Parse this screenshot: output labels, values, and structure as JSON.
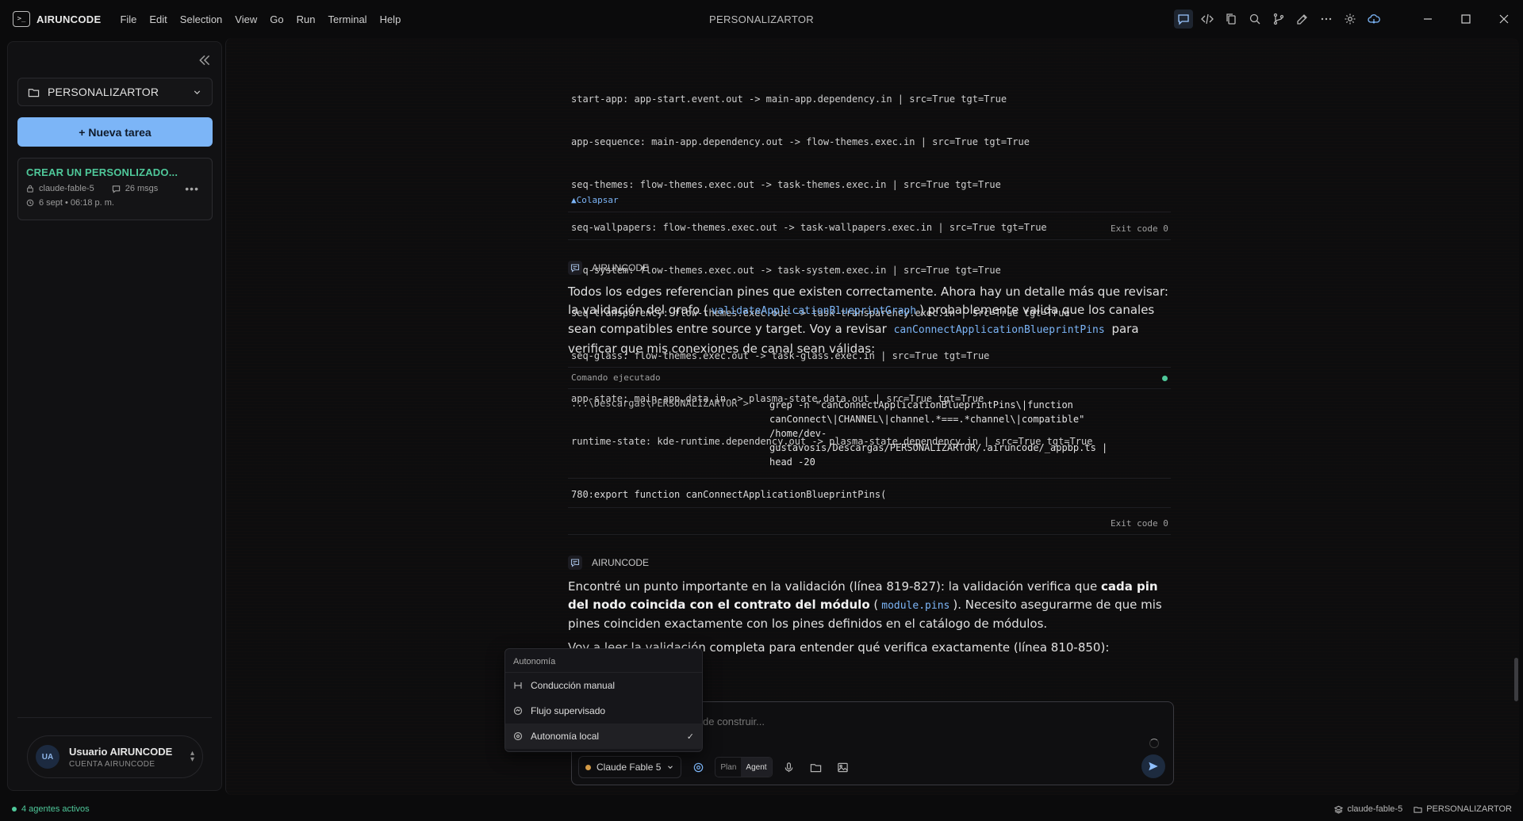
{
  "app": {
    "logo_glyph": ">_",
    "name": "AIRUNCODE",
    "window_title": "PERSONALIZARTOR"
  },
  "menu": [
    "File",
    "Edit",
    "Selection",
    "View",
    "Go",
    "Run",
    "Terminal",
    "Help"
  ],
  "sidebar": {
    "project": "PERSONALIZARTOR",
    "new_task": "+ Nueva tarea",
    "task": {
      "title": "CREAR UN PERSONLIZADO...",
      "agent": "claude-fable-5",
      "messages": "26 msgs",
      "date": "6 sept • 06:18 p. m."
    },
    "user": {
      "initials": "UA",
      "name": "Usuario AIRUNCODE",
      "account": "CUENTA AIRUNCODE"
    }
  },
  "conversation": {
    "edge_lines": [
      "start-app: app-start.event.out -> main-app.dependency.in | src=True tgt=True",
      "app-sequence: main-app.dependency.out -> flow-themes.exec.in | src=True tgt=True",
      "seq-themes: flow-themes.exec.out -> task-themes.exec.in | src=True tgt=True",
      "seq-wallpapers: flow-themes.exec.out -> task-wallpapers.exec.in | src=True tgt=True",
      "seq-system: flow-themes.exec.out -> task-system.exec.in | src=True tgt=True",
      "seq-transparency: flow-themes.exec.out -> task-transparency.exec.in | src=True tgt=True",
      "seq-glass: flow-themes.exec.out -> task-glass.exec.in | src=True tgt=True",
      "app-state: main-app.data.in -> plasma-state.data.out | src=True tgt=True",
      "runtime-state: kde-runtime.dependency.out -> plasma-state.dependency.in | src=True tgt=True"
    ],
    "collapse_label": "▲Colapsar",
    "exit_code_1": "Exit code 0",
    "agent_name_1": "AIRUNCODE",
    "msg1": {
      "t1": "Todos los edges referencian pines que existen correctamente. Ahora hay un detalle más que revisar: la validación del grafo (",
      "c1": "validateApplicationBlueprintGraph",
      "t2": ") probablemente valida que los canales sean compatibles entre source y target. Voy a revisar",
      "c2": "canConnectApplicationBlueprintPins",
      "t3": "para verificar que mis conexiones de canal sean válidas:"
    },
    "command_label": "Comando ejecutado",
    "command_prompt": "...\\Descargas\\PERSONALIZARTOR >",
    "command_text": "grep -n \"canConnectApplicationBlueprintPins\\|function\ncanConnect\\|CHANNEL\\|channel.*===.*channel\\|compatible\"\n/home/dev-\ngustavosis/Descargas/PERSONALIZARTOR/.airuncode/_appbp.ts |\nhead -20",
    "command_output": "780:export function canConnectApplicationBlueprintPins(",
    "exit_code_2": "Exit code 0",
    "agent_name_2": "AIRUNCODE",
    "msg2": {
      "t1": "Encontré un punto importante en la validación (línea 819-827): la validación verifica que ",
      "b1": "cada pin del nodo coincida con el contrato del módulo",
      "t2": " (",
      "c1": "module.pins",
      "t3": "). Necesito asegurarme de que mis pines coinciden exactamente con los pines definidos en el catálogo de módulos."
    },
    "msg3": "Voy a leer la validación completa para entender qué verifica exactamente (línea 810-850):"
  },
  "autonomy_menu": {
    "header": "Autonomía",
    "items": [
      {
        "label": "Conducción manual",
        "icon": "steering-icon",
        "selected": false
      },
      {
        "label": "Flujo supervisado",
        "icon": "eye-flow-icon",
        "selected": false
      },
      {
        "label": "Autonomía local",
        "icon": "target-icon",
        "selected": true
      }
    ],
    "check": "✓"
  },
  "composer": {
    "placeholder": "Escribe una instrucción o pide construir...",
    "model": "Claude Fable 5",
    "mode_plan": "Plan",
    "mode_agent": "Agent"
  },
  "statusbar": {
    "agents": "4 agentes activos",
    "model": "claude-fable-5",
    "project": "PERSONALIZARTOR"
  },
  "colors": {
    "accent": "#7cb5f7",
    "success": "#4fc89a",
    "model_dot": "#e0a34a"
  }
}
